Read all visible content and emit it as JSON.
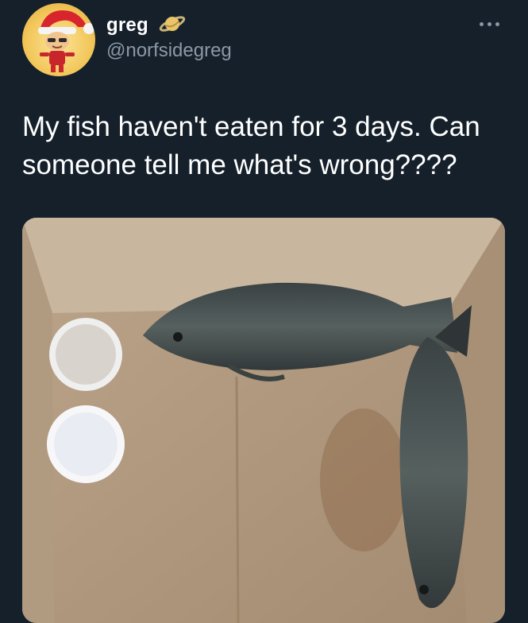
{
  "tweet": {
    "display_name": "greg",
    "handle": "@norfsidegreg",
    "text": "My fish haven't eaten for 3 days. Can someone tell me what's wrong????",
    "icons": {
      "avatar": "avatar-christmas-character",
      "badge": "planet-emoji-icon",
      "more": "more-options-icon"
    },
    "media_description_icons": [
      "fish-icon",
      "bowl-icon"
    ]
  },
  "theme": {
    "background": "#15202b",
    "text_primary": "#ffffff",
    "text_secondary": "#8b98a5"
  }
}
